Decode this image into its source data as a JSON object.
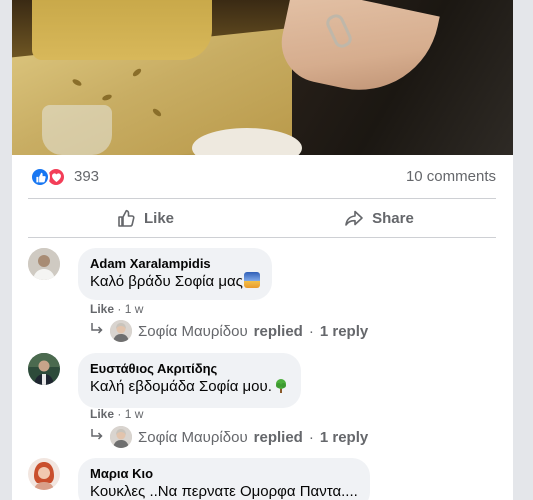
{
  "post": {
    "reaction_count": "393",
    "comments_label": "10 comments",
    "reaction_icons": [
      "like-icon",
      "love-icon"
    ],
    "colors": {
      "like_blue": "#1877f2",
      "love_red": "#f33e58",
      "secondary_text": "#65676b",
      "bubble": "#f0f2f5"
    }
  },
  "actions": {
    "like_label": "Like",
    "share_label": "Share"
  },
  "comments": [
    {
      "author": "Adam Xaralampidis",
      "text": "Καλό βράδυ Σοφία μας",
      "like_label": "Like",
      "time": "1 w",
      "reply": {
        "name": "Σοφία Μαυρίδου",
        "replied": "replied",
        "count": "1 reply"
      }
    },
    {
      "author": "Ευστάθιος Ακριτίδης",
      "text": "Καλή εβδομάδα Σοφία μου.",
      "like_label": "Like",
      "time": "1 w",
      "reply": {
        "name": "Σοφία Μαυρίδου",
        "replied": "replied",
        "count": "1 reply"
      }
    },
    {
      "author": "Μαρια Κιο",
      "text": "Κουκλες ..Να περνατε Ομορφα Παντα...."
    }
  ]
}
